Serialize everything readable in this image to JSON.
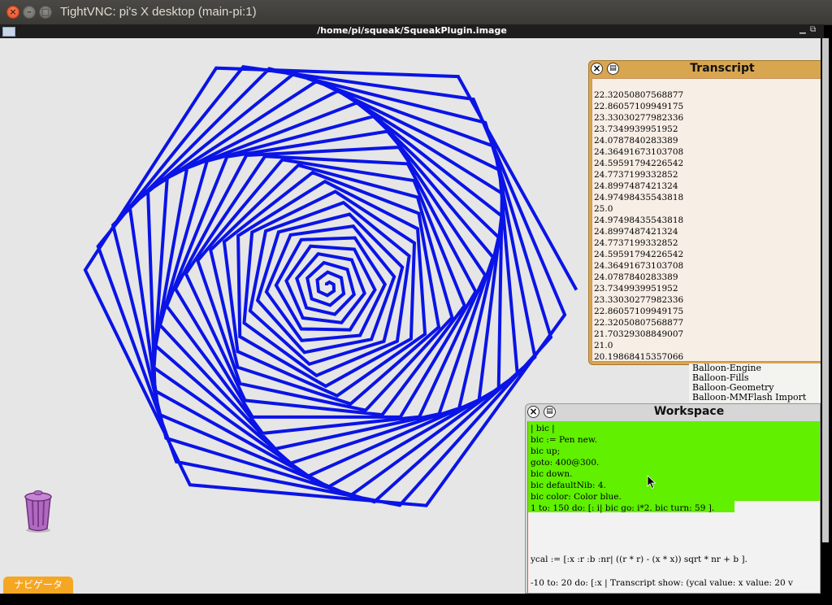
{
  "vnc": {
    "title": "TightVNC: pi's X desktop (main-pi:1)"
  },
  "squeak": {
    "image_path": "/home/pi/squeak/SqueakPlugin.image",
    "navigator_label": "ナビゲータ"
  },
  "transcript": {
    "title": "Transcript",
    "lines": [
      "22.32050807568877",
      "22.86057109949175",
      "23.33030277982336",
      "23.7349939951952",
      "24.0787840283389",
      "24.36491673103708",
      "24.59591794226542",
      "24.7737199332852",
      "24.8997487421324",
      "24.97498435543818",
      "25.0",
      "24.97498435543818",
      "24.8997487421324",
      "24.7737199332852",
      "24.59591794226542",
      "24.36491673103708",
      "24.0787840283389",
      "23.7349939951952",
      "23.33030277982336",
      "22.86057109949175",
      "22.32050807568877",
      "21.70329308849007",
      "21.0",
      "20.19868415357066"
    ]
  },
  "package_list": {
    "items": [
      "Balloon-Engine",
      "Balloon-Fills",
      "Balloon-Geometry",
      "Balloon-MMFlash Import"
    ]
  },
  "workspace": {
    "title": "Workspace",
    "code_lines": [
      "| bic |",
      "bic := Pen new.",
      "bic up;",
      "goto: 400@300.",
      "bic down.",
      "bic defaultNib: 4.",
      "bic color: Color blue.",
      "1 to: 150 do: [: i| bic go: i*2. bic turn: 59 ]."
    ],
    "ycal_line": "ycal := [:x :r :b :nr| ((r * r) - (x * x)) sqrt * nr + b ].",
    "loop_line": "-10 to: 20 do: [:x | Transcript show: (ycal value: x value: 20 v"
  },
  "drawing": {
    "pen_color": "#0a14e6",
    "pen_width": 4,
    "steps": 150,
    "step_multiplier": 2,
    "turn_degrees": 59
  }
}
